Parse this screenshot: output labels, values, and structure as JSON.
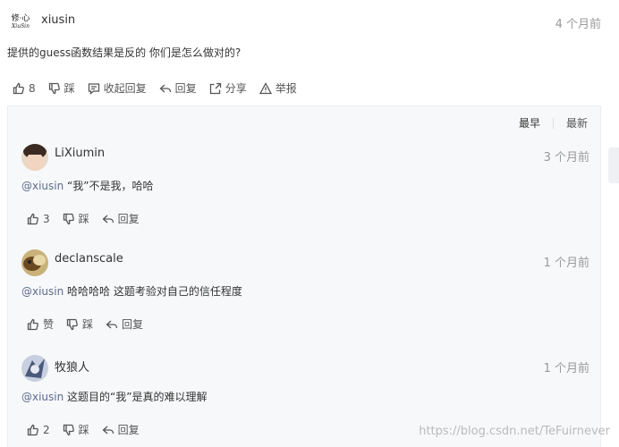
{
  "top_comment": {
    "avatar_text_line1": "修·心",
    "avatar_text_line2": "XiuSin",
    "username": "xiusin",
    "time": "4 个月前",
    "text": "提供的guess函数结果是反的 你们是怎么做对的?",
    "actions": {
      "like_count": "8",
      "dislike": "踩",
      "collapse_replies": "收起回复",
      "reply": "回复",
      "share": "分享",
      "report": "举报"
    }
  },
  "sort": {
    "earliest": "最早",
    "newest": "最新"
  },
  "replies": [
    {
      "username": "LiXiumin",
      "time": "3 个月前",
      "mention": "@xiusin",
      "text": " “我”不是我，哈哈",
      "like": "3",
      "dislike": "踩",
      "reply": "回复",
      "avatar_color": "#7a5a4a"
    },
    {
      "username": "declanscale",
      "time": "1 个月前",
      "mention": "@xiusin",
      "text": " 哈哈哈哈 这题考验对自己的信任程度",
      "like": "赞",
      "dislike": "踩",
      "reply": "回复",
      "avatar_color": "#b08a3a"
    },
    {
      "username": "牧狼人",
      "time": "1 个月前",
      "mention": "@xiusin",
      "text": " 这题目的“我”是真的难以理解",
      "like": "2",
      "dislike": "踩",
      "reply": "回复",
      "avatar_color": "#6a7a9a"
    }
  ],
  "watermark": "https://blog.csdn.net/TeFuirnever"
}
